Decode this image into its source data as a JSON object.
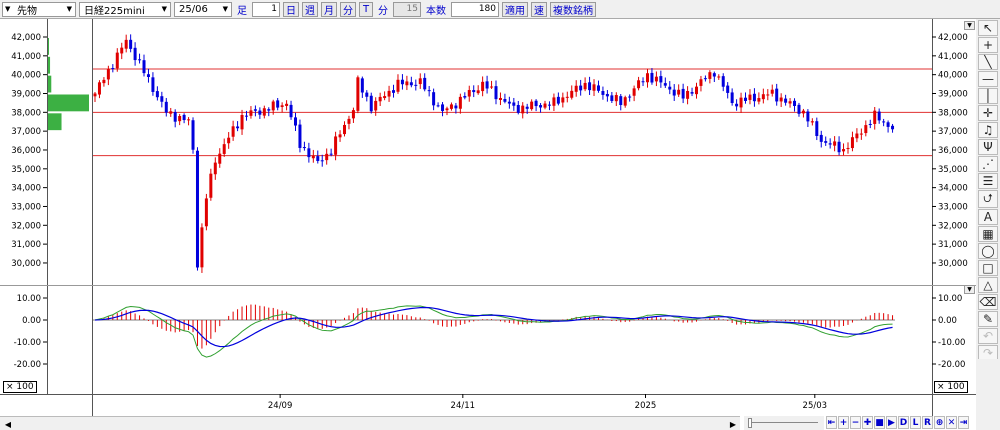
{
  "toolbar": {
    "market": "先物",
    "symbol": "日経225mini",
    "contract": "25/06",
    "bar_label": "足",
    "bar_count": "1",
    "periods": [
      "日",
      "週",
      "月",
      "分",
      "T"
    ],
    "minute_label": "分",
    "minute_value": "15",
    "bars_label": "本数",
    "bars_value": "180",
    "apply": "適用",
    "fast": "速",
    "multi": "複数銘柄"
  },
  "price_axis": {
    "labels": [
      "42,000",
      "41,000",
      "40,000",
      "39,000",
      "38,000",
      "37,000",
      "36,000",
      "35,000",
      "34,000",
      "33,000",
      "32,000",
      "31,000",
      "30,000"
    ],
    "values": [
      42000,
      41000,
      40000,
      39000,
      38000,
      37000,
      36000,
      35000,
      34000,
      33000,
      32000,
      31000,
      30000
    ]
  },
  "macd_axis": {
    "labels": [
      "10.00",
      "0.00",
      "-10.00",
      "-20.00"
    ],
    "values": [
      10,
      0,
      -10,
      -20
    ],
    "multiplier": "× 100"
  },
  "x_axis": {
    "labels": [
      {
        "text": "24/09",
        "bar": 42
      },
      {
        "text": "24/11",
        "bar": 83
      },
      {
        "text": "2025",
        "bar": 124
      },
      {
        "text": "25/03",
        "bar": 162
      }
    ]
  },
  "colors": {
    "up": "#e00000",
    "down": "#0000dd",
    "hline": "#e03030",
    "macd": "#30a030",
    "signal": "#0000dd",
    "hist": "#e00000",
    "volume": "#3cb043"
  },
  "chart_data": {
    "type": "candlestick",
    "bars": 180,
    "ylim": [
      29600,
      42400
    ],
    "horizontal_lines": [
      40300,
      38000,
      35700
    ],
    "close_waypoints": [
      [
        0,
        39000
      ],
      [
        7,
        41800
      ],
      [
        9,
        41000
      ],
      [
        16,
        38000
      ],
      [
        21,
        37500
      ],
      [
        22,
        36000
      ],
      [
        23,
        30000
      ],
      [
        25,
        33500
      ],
      [
        27,
        35500
      ],
      [
        33,
        37800
      ],
      [
        43,
        38500
      ],
      [
        46,
        36300
      ],
      [
        50,
        35300
      ],
      [
        53,
        36000
      ],
      [
        58,
        38200
      ],
      [
        59,
        39600
      ],
      [
        62,
        38300
      ],
      [
        68,
        39500
      ],
      [
        73,
        39600
      ],
      [
        78,
        38000
      ],
      [
        87,
        39500
      ],
      [
        94,
        38200
      ],
      [
        103,
        38500
      ],
      [
        110,
        39500
      ],
      [
        118,
        38500
      ],
      [
        124,
        40000
      ],
      [
        132,
        38800
      ],
      [
        139,
        40200
      ],
      [
        143,
        38500
      ],
      [
        152,
        39000
      ],
      [
        159,
        38000
      ],
      [
        163,
        36500
      ],
      [
        168,
        36000
      ],
      [
        175,
        37800
      ],
      [
        180,
        37000
      ]
    ],
    "volume_profile": [
      [
        41000,
        42000,
        0.02
      ],
      [
        40000,
        41000,
        0.05
      ],
      [
        39000,
        40000,
        0.08
      ],
      [
        38000,
        39000,
        1.0
      ],
      [
        37000,
        38000,
        0.33
      ]
    ],
    "macd": {
      "fast": 12,
      "slow": 26,
      "signal": 9,
      "scale": 100
    }
  },
  "bottom": {
    "buttons": [
      "⇤",
      "+",
      "−",
      "✚",
      "■",
      "▶",
      "D",
      "L",
      "R",
      "⊕",
      "✕",
      "⇥"
    ]
  },
  "right_tools": [
    "↖",
    "+",
    "╲",
    "—",
    "│",
    "✛",
    "♫",
    "Ψ",
    "⋰",
    "☰",
    "⮍",
    "A",
    "▦",
    "◯",
    "□",
    "△",
    "⌫",
    "✎",
    "↶",
    "↷"
  ]
}
